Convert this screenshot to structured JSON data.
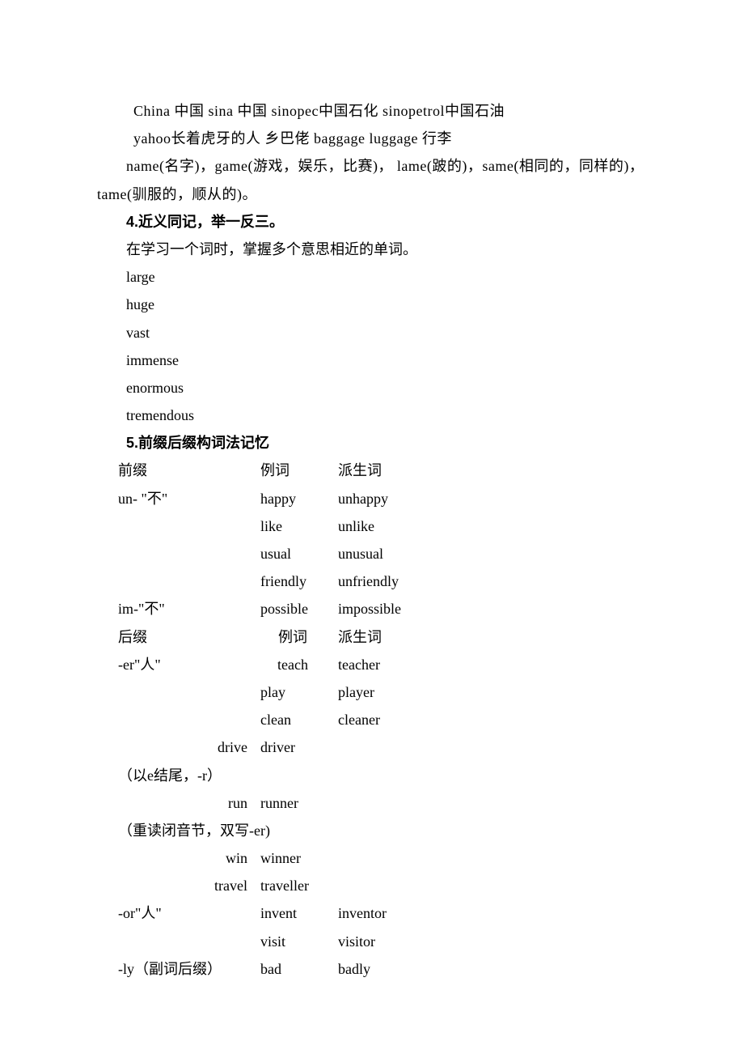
{
  "line1": "China  中国  sina  中国  sinopec中国石化  sinopetrol中国石油",
  "line2": "yahoo长着虎牙的人 乡巴佬  baggage luggage  行李",
  "line3": "name(名字)，game(游戏，娱乐，比赛)，  lame(跛的)，same(相同的，同样的)，tame(驯服的，顺从的)。",
  "section4_title": "4.近义同记，举一反三。",
  "section4_desc": "在学习一个词时，掌握多个意思相近的单词。",
  "syn1": "large",
  "syn2": "huge",
  "syn3": "vast",
  "syn4": "immense",
  "syn5": "enormous",
  "syn6": "tremendous",
  "section5_title": "5.前缀后缀构词法记忆",
  "hdr_prefix": "前缀",
  "hdr_example": "例词",
  "hdr_derived": "派生词",
  "pfx_un": "un- \"不\"",
  "un1a": "happy",
  "un1b": "unhappy",
  "un2a": "like",
  "un2b": "unlike",
  "un3a": "usual",
  "un3b": "unusual",
  "un4a": "friendly",
  "un4b": "unfriendly",
  "pfx_im": "im-\"不\"",
  "im1a": "possible",
  "im1b": "impossible",
  "hdr_suffix": "后缀",
  "sfx_er": "-er\"人\"",
  "er1a": "teach",
  "er1b": "teacher",
  "er2a": "play",
  "er2b": "player",
  "er3a": "clean",
  "er3b": "cleaner",
  "er4a": "drive",
  "er4b": "driver",
  "note_e": "（以e结尾，-r）",
  "er5a": "run",
  "er5b": "runner",
  "note_double": "（重读闭音节，双写-er)",
  "er6a": "win",
  "er6b": "winner",
  "er7a": "travel",
  "er7b": "traveller",
  "sfx_or": "-or\"人\"",
  "or1a": "invent",
  "or1b": "inventor",
  "or2a": "visit",
  "or2b": "visitor",
  "sfx_ly": "-ly（副词后缀）",
  "ly1a": "bad",
  "ly1b": "badly"
}
